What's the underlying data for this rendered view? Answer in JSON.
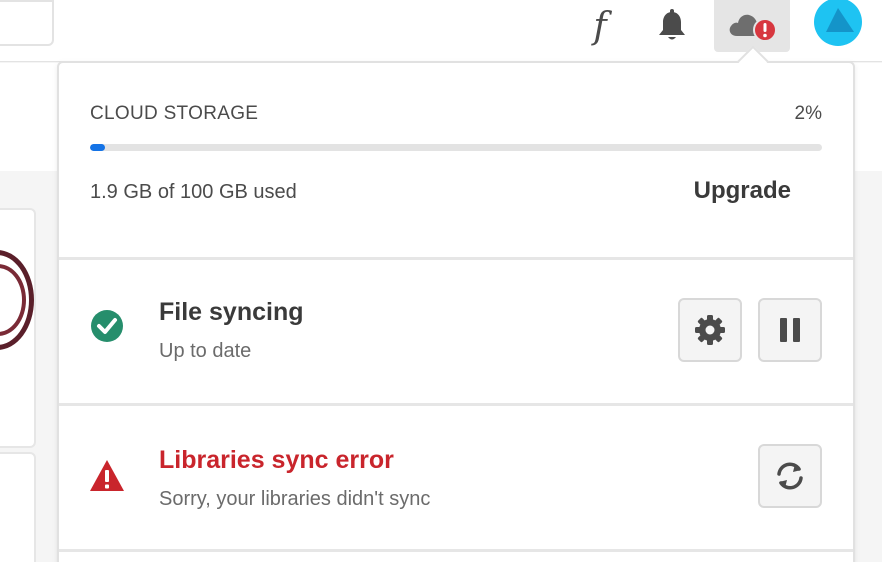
{
  "toolbar": {
    "fonts_icon_glyph": "f",
    "icons": [
      "fonts-icon",
      "bell-icon",
      "cloud-alert-icon",
      "avatar"
    ],
    "avatar_color": "#1ec3f2"
  },
  "storage": {
    "title": "CLOUD STORAGE",
    "percent_label": "2%",
    "percent_value": 2,
    "used_label": "1.9 GB of 100 GB used",
    "upgrade_label": "Upgrade",
    "bar_color": "#1473e6"
  },
  "file_sync": {
    "title": "File syncing",
    "status": "Up to date",
    "status_icon": "check-circle-icon",
    "status_color": "#268e6c",
    "buttons": [
      "gear-icon",
      "pause-icon"
    ]
  },
  "libraries_sync": {
    "title": "Libraries sync error",
    "message": "Sorry, your libraries didn't sync",
    "status_icon": "alert-triangle-icon",
    "status_color": "#c9252c",
    "buttons": [
      "refresh-icon"
    ]
  }
}
